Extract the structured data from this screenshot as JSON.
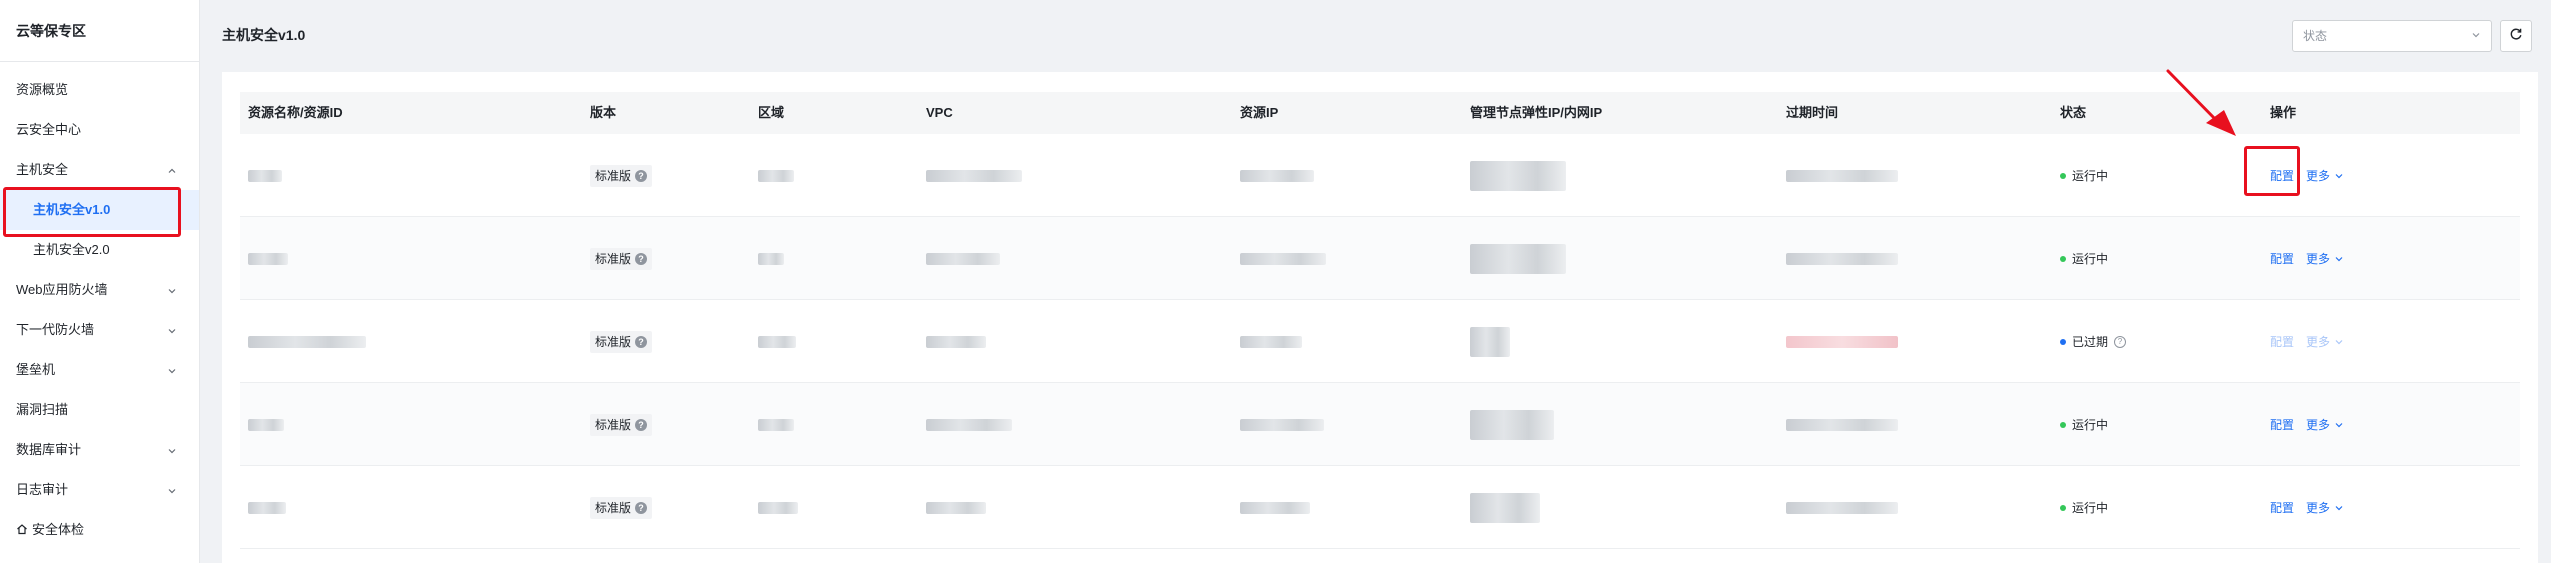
{
  "sidebar": {
    "title": "云等保专区",
    "items": [
      {
        "label": "资源概览",
        "sub": false,
        "chevron": false
      },
      {
        "label": "云安全中心",
        "sub": false,
        "chevron": false
      },
      {
        "label": "主机安全",
        "sub": false,
        "chevron": true,
        "chevron_dir": "up"
      },
      {
        "label": "主机安全v1.0",
        "sub": true,
        "active": true
      },
      {
        "label": "主机安全v2.0",
        "sub": true
      },
      {
        "label": "Web应用防火墙",
        "sub": false,
        "chevron": true
      },
      {
        "label": "下一代防火墙",
        "sub": false,
        "chevron": true
      },
      {
        "label": "堡垒机",
        "sub": false,
        "chevron": true
      },
      {
        "label": "漏洞扫描",
        "sub": false,
        "chevron": false
      },
      {
        "label": "数据库审计",
        "sub": false,
        "chevron": true
      },
      {
        "label": "日志审计",
        "sub": false,
        "chevron": true
      },
      {
        "label": "安全体检",
        "sub": false,
        "chevron": false,
        "icon": "home-icon"
      }
    ]
  },
  "header": {
    "title": "主机安全v1.0",
    "status_placeholder": "状态",
    "refresh_icon": "refresh-icon"
  },
  "table": {
    "columns": [
      "资源名称/资源ID",
      "版本",
      "区域",
      "VPC",
      "资源IP",
      "管理节点弹性IP/内网IP",
      "过期时间",
      "状态",
      "操作"
    ],
    "rows": [
      {
        "version": "标准版",
        "status": "运行中",
        "status_color": "#34c759",
        "status_info": false,
        "op_config": "配置",
        "op_more": "更多",
        "disabled": false,
        "expired": false
      },
      {
        "version": "标准版",
        "status": "运行中",
        "status_color": "#34c759",
        "status_info": false,
        "op_config": "配置",
        "op_more": "更多",
        "disabled": false,
        "expired": false
      },
      {
        "version": "标准版",
        "status": "已过期",
        "status_color": "#1f6ff2",
        "status_info": true,
        "op_config": "配置",
        "op_more": "更多",
        "disabled": true,
        "expired": true
      },
      {
        "version": "标准版",
        "status": "运行中",
        "status_color": "#34c759",
        "status_info": false,
        "op_config": "配置",
        "op_more": "更多",
        "disabled": false,
        "expired": false
      },
      {
        "version": "标准版",
        "status": "运行中",
        "status_color": "#34c759",
        "status_info": false,
        "op_config": "配置",
        "op_more": "更多",
        "disabled": false,
        "expired": false
      }
    ]
  },
  "colors": {
    "accent": "#1f6ff2",
    "highlight": "#e8101f",
    "running": "#34c759"
  }
}
